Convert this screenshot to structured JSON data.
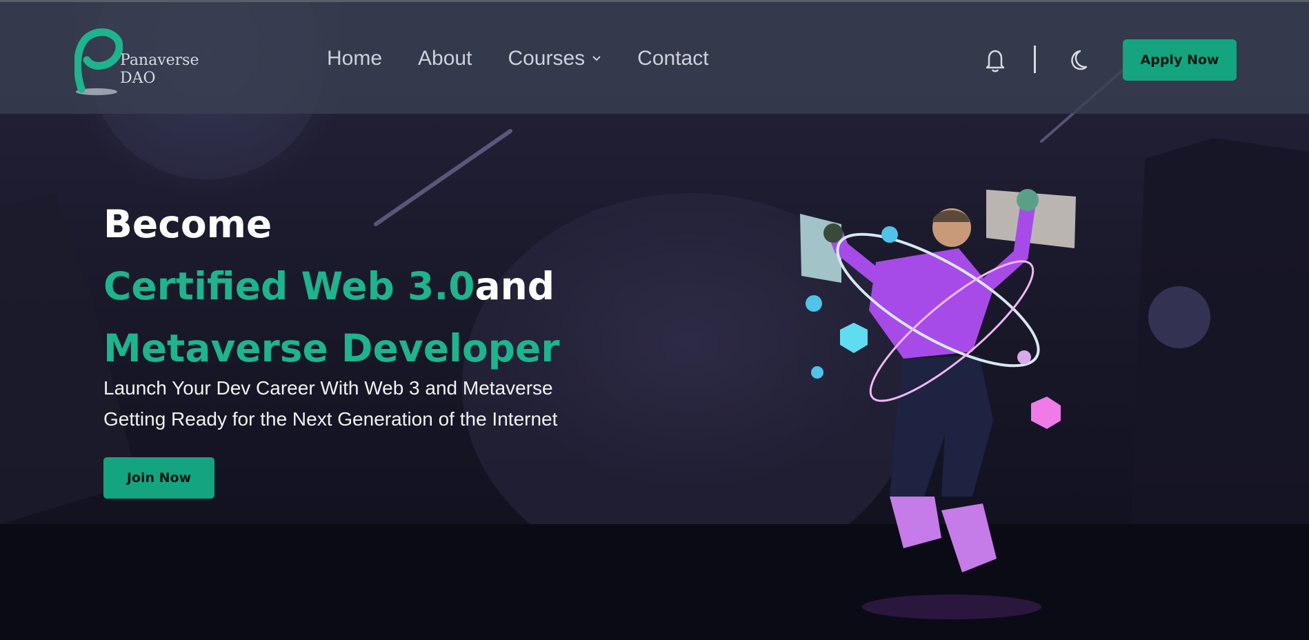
{
  "brand": {
    "name_line1": "Panaverse",
    "name_line2": "DAO",
    "accent_color": "#1eb48d"
  },
  "nav": {
    "links": [
      {
        "label": "Home"
      },
      {
        "label": "About"
      },
      {
        "label": "Courses",
        "has_dropdown": true
      },
      {
        "label": "Contact"
      }
    ],
    "icons": [
      "bell-icon",
      "moon-icon",
      "chevron-down-icon"
    ],
    "apply_label": "Apply Now"
  },
  "hero": {
    "line1": "Become",
    "line2_teal": "Certified Web 3.0",
    "line2_white": "and",
    "line3": "Metaverse Developer",
    "subtitle1": "Launch Your Dev Career With Web 3 and Metaverse",
    "subtitle2": "Getting Ready for the Next Generation of the Internet",
    "cta_label": "Join Now"
  },
  "colors": {
    "button": "#14a47f",
    "navbar": "#3a4052",
    "background": "#0d0d19"
  }
}
